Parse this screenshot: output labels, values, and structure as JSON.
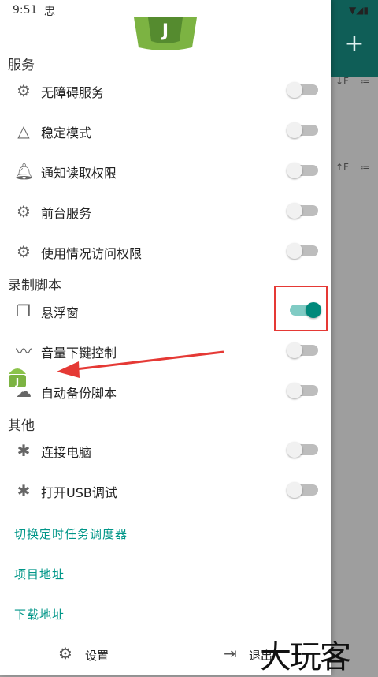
{
  "status_bar": {
    "time": "9:51",
    "notif_glyph": "忠"
  },
  "background": {
    "fab": "+",
    "sort_desc": "↓F",
    "sort_asc": "↑F",
    "list_icon": "≔"
  },
  "sections": {
    "service": "服务",
    "record": "录制脚本",
    "other": "其他"
  },
  "service_items": [
    {
      "label": "无障碍服务",
      "icon": "gear-icon",
      "on": false
    },
    {
      "label": "稳定模式",
      "icon": "triangle-icon",
      "on": false
    },
    {
      "label": "通知读取权限",
      "icon": "bell-icon",
      "on": false
    },
    {
      "label": "前台服务",
      "icon": "gear-icon",
      "on": false
    },
    {
      "label": "使用情况访问权限",
      "icon": "gear-icon",
      "on": false
    }
  ],
  "record_items": [
    {
      "label": "悬浮窗",
      "icon": "window-icon",
      "on": true
    },
    {
      "label": "音量下键控制",
      "icon": "waveform-icon",
      "on": false
    },
    {
      "label": "自动备份脚本",
      "icon": "cloud-icon",
      "on": false
    }
  ],
  "other_items": [
    {
      "label": "连接电脑",
      "icon": "bug-icon",
      "on": false
    },
    {
      "label": "打开USB调试",
      "icon": "bug-icon",
      "on": false
    }
  ],
  "links": [
    "切换定时任务调度器",
    "项目地址",
    "下载地址"
  ],
  "bottom": {
    "settings": "设置",
    "exit": "退出"
  },
  "watermark": "大玩客",
  "colors": {
    "accent": "#009688",
    "toggle_on": "#00897b",
    "highlight": "#e53935"
  }
}
